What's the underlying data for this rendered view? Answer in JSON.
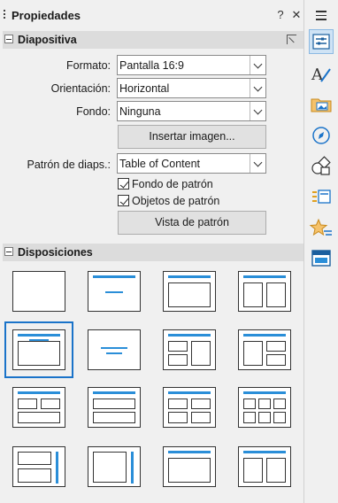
{
  "panel": {
    "title": "Propiedades",
    "help": "?",
    "close": "✕"
  },
  "slide_section": {
    "title": "Diapositiva",
    "format_label": "Formato:",
    "format_value": "Pantalla 16:9",
    "orientation_label": "Orientación:",
    "orientation_value": "Horizontal",
    "background_label": "Fondo:",
    "background_value": "Ninguna",
    "insert_image_button": "Insertar imagen...",
    "master_label": "Patrón de diaps.:",
    "master_value": "Table of Content",
    "master_background_label": "Fondo de patrón",
    "master_background_checked": true,
    "master_objects_label": "Objetos de patrón",
    "master_objects_checked": true,
    "master_view_button": "Vista de patrón"
  },
  "layouts_section": {
    "title": "Disposiciones",
    "selected_index": 4
  },
  "colors": {
    "accent": "#2a8ed8",
    "selection": "#1a73c9",
    "section_bg": "#dcdcdc"
  }
}
